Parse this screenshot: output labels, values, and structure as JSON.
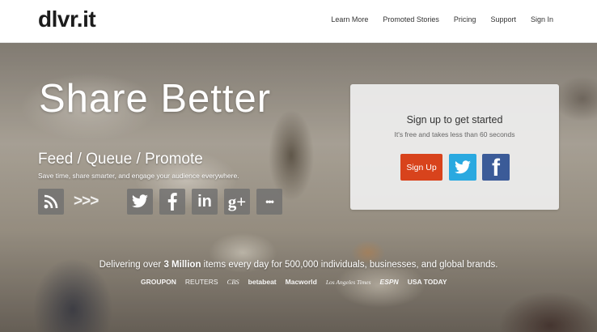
{
  "header": {
    "logo": "dlvr.it",
    "nav": [
      "Learn More",
      "Promoted Stories",
      "Pricing",
      "Support",
      "Sign In"
    ]
  },
  "hero": {
    "title": "Share Better",
    "subtitle": "Feed / Queue / Promote",
    "description": "Save time, share smarter, and engage your audience everywhere.",
    "icons": [
      "rss-icon",
      "arrows-icon",
      "twitter-icon",
      "facebook-icon",
      "linkedin-icon",
      "google-plus-icon",
      "more-icon"
    ],
    "arrows_text": ">>>",
    "linkedin_text": "in",
    "google_text": "g+",
    "more_text": "•••"
  },
  "signup_card": {
    "title": "Sign up to get started",
    "subtitle": "It's free and takes less than 60 seconds",
    "signup_label": "Sign Up",
    "facebook_letter": "f",
    "colors": {
      "signup": "#d8431c",
      "twitter": "#2aa9e0",
      "facebook": "#3b5b98"
    }
  },
  "stats": {
    "prefix": "Delivering over ",
    "highlight": "3 Million",
    "suffix": " items every day for 500,000 individuals, businesses, and global brands."
  },
  "brands": [
    "GROUPON",
    "REUTERS",
    "CBS",
    "betabeat",
    "Macworld",
    "Los Angeles Times",
    "ESPN",
    "USA TODAY"
  ]
}
